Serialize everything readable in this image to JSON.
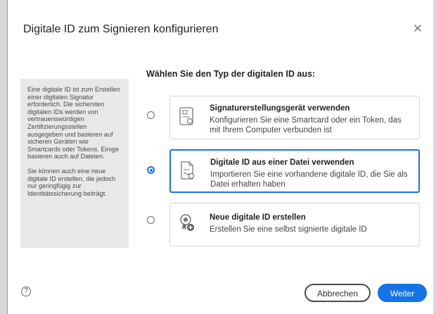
{
  "dialog": {
    "title": "Digitale ID zum Signieren konfigurieren",
    "close_icon": "close-icon"
  },
  "info": {
    "paragraph1": "Eine digitale ID ist zum Erstellen einer digitalen Signatur erforderlich. Die sichersten digitalen IDs werden von vertrauenswürdigen Zertifizierungsstellen ausgegeben und basieren auf sicheren Geräten wie Smartcards oder Tokens. Einige basieren auch auf Dateien.",
    "paragraph2": "Sie können auch eine neue digitale ID erstellen, die jedoch nur geringfügig zur Identitätssicherung beiträgt."
  },
  "question": "Wählen Sie den Typ der digitalen ID aus:",
  "options": [
    {
      "title": "Signaturerstellungsgerät verwenden",
      "description": "Konfigurieren Sie eine Smartcard oder ein Token, das mit Ihrem Computer verbunden ist",
      "icon": "smartcard-device-icon",
      "selected": false
    },
    {
      "title": "Digitale ID aus einer Datei verwenden",
      "description": "Importieren Sie eine vorhandene digitale ID, die Sie als Datei erhalten haben",
      "icon": "certificate-file-icon",
      "selected": true
    },
    {
      "title": "Neue digitale ID erstellen",
      "description": "Erstellen Sie eine selbst signierte digitale ID",
      "icon": "new-certificate-icon",
      "selected": false
    }
  ],
  "footer": {
    "help_glyph": "?",
    "cancel_label": "Abbrechen",
    "continue_label": "Weiter"
  },
  "colors": {
    "accent": "#1473e6",
    "panel": "#e8e8e8"
  }
}
